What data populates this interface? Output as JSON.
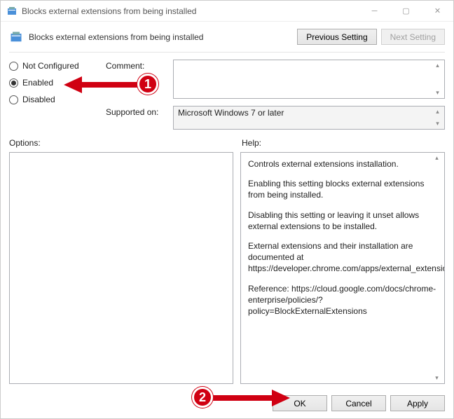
{
  "window": {
    "title": "Blocks external extensions from being installed"
  },
  "header": {
    "title": "Blocks external extensions from being installed",
    "prev": "Previous Setting",
    "next": "Next Setting"
  },
  "state": {
    "not_configured": "Not Configured",
    "enabled": "Enabled",
    "disabled": "Disabled",
    "selected": "enabled"
  },
  "fields": {
    "comment_label": "Comment:",
    "comment_value": "",
    "supported_label": "Supported on:",
    "supported_value": "Microsoft Windows 7 or later"
  },
  "labels": {
    "options": "Options:",
    "help": "Help:"
  },
  "help": {
    "p1": "Controls external extensions installation.",
    "p2": "Enabling this setting blocks external extensions from being installed.",
    "p3": "Disabling this setting or leaving it unset allows external extensions to be installed.",
    "p4": "External extensions and their installation are documented at https://developer.chrome.com/apps/external_extensions.",
    "p5": "Reference: https://cloud.google.com/docs/chrome-enterprise/policies/?policy=BlockExternalExtensions"
  },
  "footer": {
    "ok": "OK",
    "cancel": "Cancel",
    "apply": "Apply"
  },
  "annotations": {
    "c1": "1",
    "c2": "2"
  }
}
